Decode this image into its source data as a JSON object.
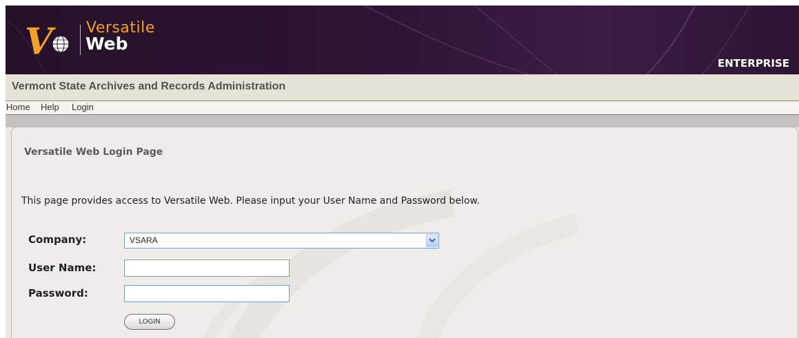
{
  "header": {
    "brand_line1": "Versatile",
    "brand_line2": "Web",
    "logo_letter": "V",
    "edition": "ENTERPRISE",
    "colors": {
      "banner": "#2d1433",
      "brand_orange": "#f0a12a",
      "brand_white": "#ffffff"
    }
  },
  "org": {
    "title": "Vermont State Archives and Records Administration"
  },
  "nav": {
    "items": [
      "Home",
      "Help",
      "Login"
    ]
  },
  "page": {
    "title": "Versatile Web Login Page",
    "intro": "This page provides access to Versatile Web. Please input your User Name and Password below."
  },
  "form": {
    "company_label": "Company:",
    "company_value": "VSARA",
    "username_label": "User Name:",
    "username_value": "",
    "password_label": "Password:",
    "password_value": "",
    "login_label": "LOGIN"
  },
  "icons": {
    "logo": "versatile-globe-logo",
    "select_arrow": "chevron-down-icon"
  }
}
